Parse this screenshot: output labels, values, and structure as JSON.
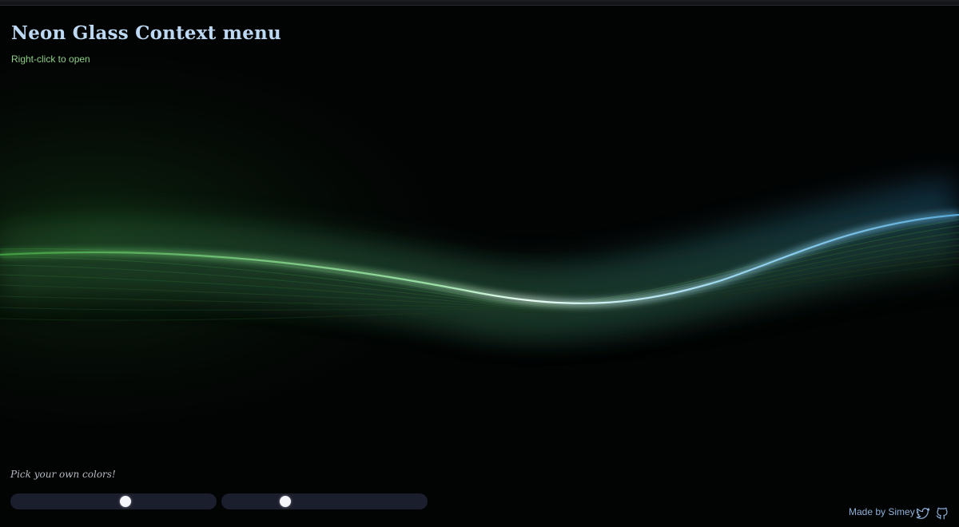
{
  "header": {
    "title": "Neon Glass Context menu",
    "subtitle": "Right-click to open"
  },
  "controls": {
    "prompt": "Pick your own colors!",
    "sliders": [
      {
        "name": "color-slider-1",
        "value_fraction": 0.56
      },
      {
        "name": "color-slider-2",
        "value_fraction": 0.31
      }
    ]
  },
  "footer": {
    "credit": "Made by Simey",
    "icons": [
      "twitter-icon",
      "github-icon"
    ]
  },
  "colors": {
    "background": "#020303",
    "title": "#bcd8f2",
    "subtitle": "#8fcf86",
    "wave_green": "#5fbf5a",
    "wave_blue": "#6fc4f0",
    "slider_track": "#1b1e2c",
    "credit": "#8fb1d9"
  }
}
